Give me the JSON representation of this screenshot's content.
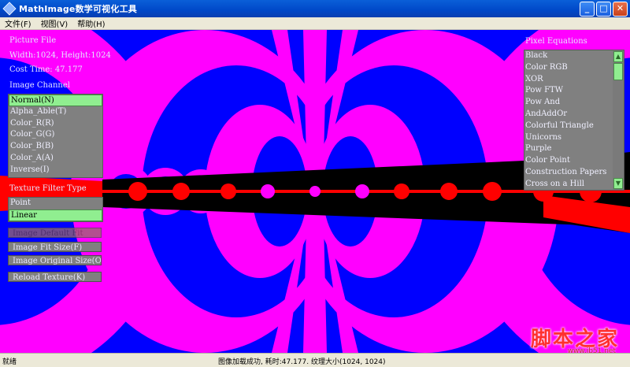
{
  "window": {
    "title": "MathImage数学可视化工具",
    "icon": "app-icon",
    "controls": [
      "minimize-icon",
      "maximize-icon",
      "close-icon"
    ]
  },
  "menu": {
    "items": [
      {
        "label": "文件(F)"
      },
      {
        "label": "视图(V)"
      },
      {
        "label": "帮助(H)"
      }
    ]
  },
  "info": {
    "section_title": "Picture File",
    "size_text": "Width:1024, Height:1024",
    "cost_text": "Cost Time: 47.177"
  },
  "channel": {
    "title": "Image Channel",
    "items": [
      "Normal(N)",
      "Alpha_Able(T)",
      "Color_R(R)",
      "Color_G(G)",
      "Color_B(B)",
      "Color_A(A)",
      "Inverse(I)"
    ],
    "selected_index": 0
  },
  "filter": {
    "title": "Texture Filter Type",
    "items": [
      "Point",
      "Linear"
    ],
    "selected_index": 1
  },
  "buttons": {
    "default_fit": "Image Default Fit",
    "fit_size": "Image Fit Size(F)",
    "original_size": "Image Original Size(O)",
    "reload": "Reload Texture(K)"
  },
  "equations": {
    "title": "Pixel Equations",
    "items": [
      "Black",
      "Color RGB",
      "XOR",
      "Pow FTW",
      "Pow And",
      "AndAddOr",
      "Colorful Triangle",
      "Unicorns",
      "Purple",
      "Color Point",
      "Construction Papers",
      "Cross on a Hill"
    ]
  },
  "status": {
    "ready": "就绪",
    "message": "图像加载成功, 耗时:47.177. 纹理大小(1024, 1024)"
  },
  "watermark": {
    "text": "脚本之家",
    "url": "www.jb51.net"
  },
  "colors": {
    "blue": "#0000ff",
    "magenta": "#ff00ff",
    "red": "#ff0000",
    "black": "#000000",
    "list_bg": "#808080",
    "selected": "#90ee90"
  }
}
